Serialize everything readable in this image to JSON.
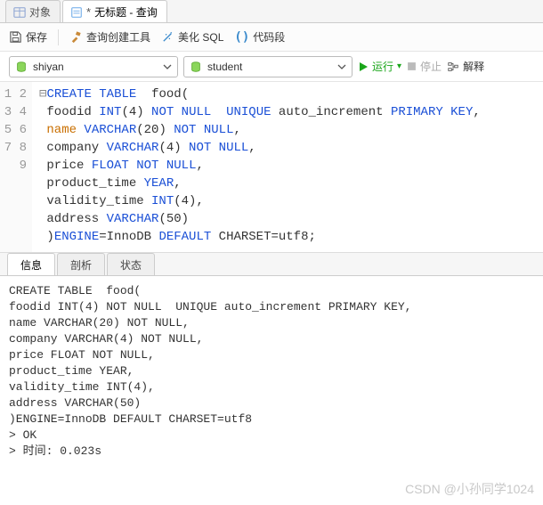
{
  "tabs": {
    "object": "对象",
    "query_prefix": "*",
    "query_title": "无标题 - 查询"
  },
  "toolbar": {
    "save": "保存",
    "builder": "查询创建工具",
    "beautify": "美化 SQL",
    "snippet": "代码段"
  },
  "selects": {
    "db": "shiyan",
    "schema": "student"
  },
  "actions": {
    "run": "运行",
    "stop": "停止",
    "explain": "解释"
  },
  "code": {
    "lines": [
      "CREATE TABLE  food(",
      "foodid INT(4) NOT NULL  UNIQUE auto_increment PRIMARY KEY,",
      "name VARCHAR(20) NOT NULL,",
      "company VARCHAR(4) NOT NULL,",
      "price FLOAT NOT NULL,",
      "product_time YEAR,",
      "validity_time INT(4),",
      "address VARCHAR(50)",
      ")ENGINE=InnoDB DEFAULT CHARSET=utf8;"
    ]
  },
  "bottom_tabs": {
    "info": "信息",
    "profile": "剖析",
    "status": "状态"
  },
  "output_text": "CREATE TABLE  food(\nfoodid INT(4) NOT NULL  UNIQUE auto_increment PRIMARY KEY,\nname VARCHAR(20) NOT NULL,\ncompany VARCHAR(4) NOT NULL,\nprice FLOAT NOT NULL,\nproduct_time YEAR,\nvalidity_time INT(4),\naddress VARCHAR(50)\n)ENGINE=InnoDB DEFAULT CHARSET=utf8\n> OK\n> 时间: 0.023s",
  "watermark": "CSDN @小孙同学1024"
}
